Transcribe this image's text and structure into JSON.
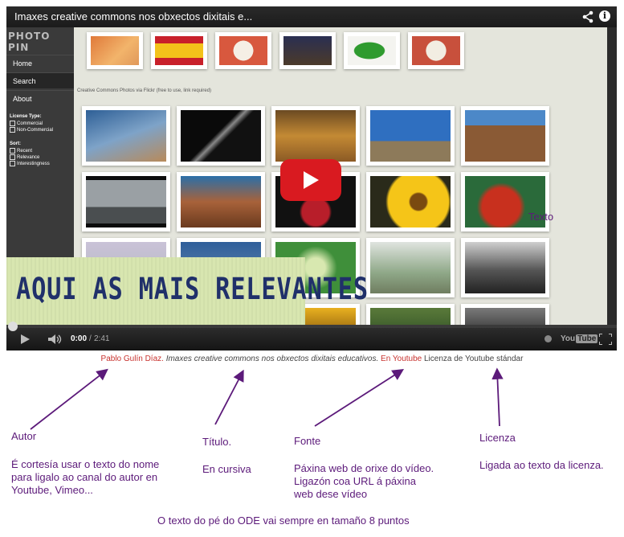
{
  "player": {
    "title": "Imaxes creative commons nos obxectos dixitais e...",
    "icons": [
      "share-icon",
      "info-icon",
      "play-icon",
      "volume-icon",
      "settings-icon",
      "fullscreen-icon"
    ],
    "time_current": "0:00",
    "time_separator": "/",
    "time_total": "2:41",
    "progress": 0,
    "youtube_logo": {
      "you": "You",
      "tube": "Tube"
    },
    "play_button_color": "#d91a20"
  },
  "site": {
    "logo": "PHOTO PIN",
    "nav": [
      "Home",
      "Search",
      "About"
    ],
    "license_heading": "License Type:",
    "license_options": [
      "Commercial",
      "Non-Commercial"
    ],
    "sort_heading": "Sort:",
    "sort_options": [
      "Recent",
      "Relevance",
      "Interestingness"
    ],
    "cc_label": "Creative Commons Photos via Flickr (free to use, link required)"
  },
  "banner": {
    "text": "AQUI AS MAIS RELEVANTES"
  },
  "overlay_label": "Texto",
  "caption": {
    "author": "Pablo Gulín Díaz.",
    "title": "Imaxes creative commons nos obxectos dixitais educativos.",
    "source": "En Youtube",
    "license": "Licenza de Youtube stándar"
  },
  "annotations": {
    "autor": {
      "label": "Autor",
      "lines": [
        "É cortesía usar o texto do nome",
        "para ligalo ao canal do autor en",
        "Youtube, Vimeo..."
      ]
    },
    "titulo": {
      "label": "Título.",
      "lines": [
        "En cursiva"
      ]
    },
    "fonte": {
      "label": "Fonte",
      "lines": [
        "Páxina web de orixe do vídeo.",
        "Ligazón coa URL á páxina",
        "web dese vídeo"
      ]
    },
    "licenza": {
      "label": "Licenza",
      "lines": [
        "Ligada ao texto da licenza."
      ]
    },
    "footer": "O texto do pé do ODE vai sempre en tamaño 8 puntos"
  },
  "colors": {
    "annotation": "#5c1a7a",
    "caption_link": "#c8322e"
  }
}
